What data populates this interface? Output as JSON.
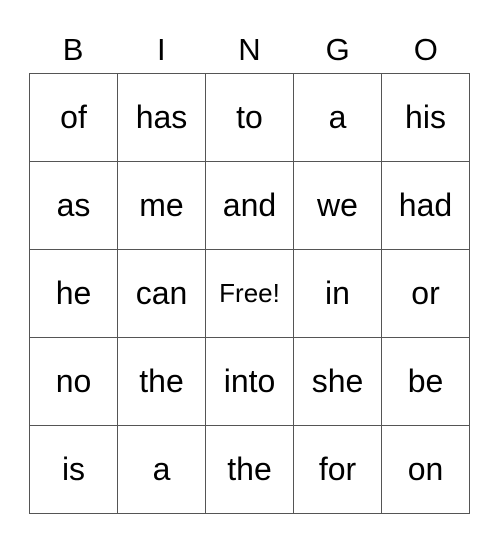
{
  "header": [
    "B",
    "I",
    "N",
    "G",
    "O"
  ],
  "rows": [
    [
      "of",
      "has",
      "to",
      "a",
      "his"
    ],
    [
      "as",
      "me",
      "and",
      "we",
      "had"
    ],
    [
      "he",
      "can",
      "Free!",
      "in",
      "or"
    ],
    [
      "no",
      "the",
      "into",
      "she",
      "be"
    ],
    [
      "is",
      "a",
      "the",
      "for",
      "on"
    ]
  ],
  "free_label": "Free!"
}
